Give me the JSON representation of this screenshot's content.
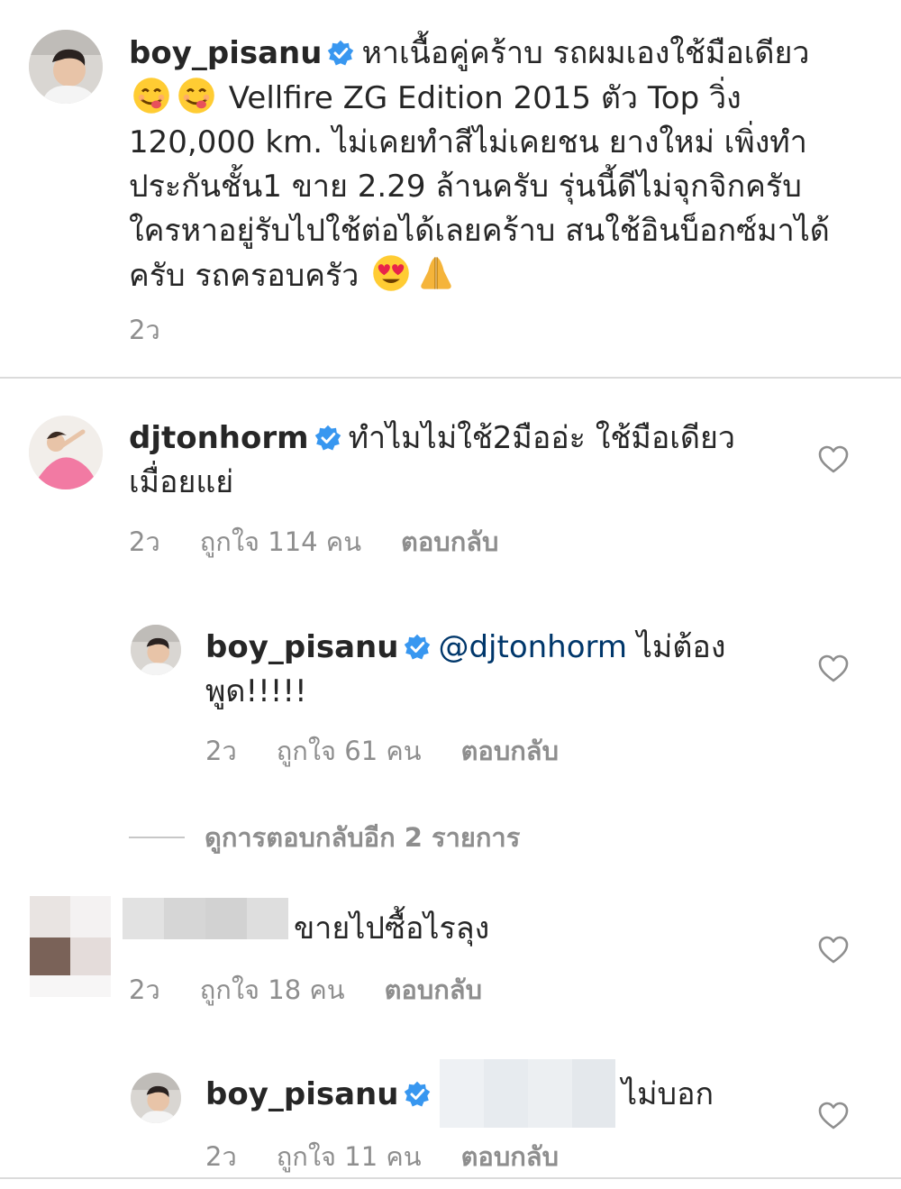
{
  "post": {
    "username": "boy_pisanu",
    "text_1": "หาเนื้อคู่คร้าบ รถผมเองใช้มือเดียว",
    "text_2": " Vellfire ZG Edition 2015 ตัว Top วิ่ง",
    "text_3": "120,000 km. ไม่เคยทำสีไม่เคยชน ยางใหม่ เพิ่งทำ",
    "text_4": "ประกันชั้น1 ขาย 2.29 ล้านครับ รุ่นนี้ดีไม่จุกจิกครับ",
    "text_5": "ใครหาอยู่รับไปใช้ต่อได้เลยคร้าบ สนใช้อินบ็อกซ์มาได้",
    "text_6": "ครับ รถครอบครัว ",
    "time": "2ว",
    "emojis": [
      "yum-face",
      "yum-face",
      "heart-eyes-face",
      "folded-hands"
    ]
  },
  "comments": [
    {
      "username": "djtonhorm",
      "text": "ทำไมไม่ใช้2มืออ่ะ ใช้มือเดียวเมื่อยแย่",
      "text_line1": "ทำไมไม่ใช้2มืออ่ะ ใช้มือเดียว",
      "text_line2": "เมื่อยแย่",
      "time": "2ว",
      "likes": "ถูกใจ 114 คน",
      "reply_label": "ตอบกลับ"
    },
    {
      "username": "boy_pisanu",
      "mention": "@djtonhorm",
      "text_line1": " ไม่ต้อง",
      "text_line2": "พูด!!!!!",
      "time": "2ว",
      "likes": "ถูกใจ 61 คน",
      "reply_label": "ตอบกลับ"
    },
    {
      "username": "",
      "text": "ขายไปซื้อไรลุง",
      "time": "2ว",
      "likes": "ถูกใจ 18 คน",
      "reply_label": "ตอบกลับ"
    },
    {
      "username": "boy_pisanu",
      "mention_prefix": "(",
      "text": "ไม่บอก",
      "time": "2ว",
      "likes": "ถูกใจ 11 คน",
      "reply_label": "ตอบกลับ"
    }
  ],
  "view_replies": "ดูการตอบกลับอีก 2 รายการ",
  "colors": {
    "verified": "#3897f0",
    "meta": "#8e8e8e",
    "mention": "#00376b",
    "divider": "#dbdbdb"
  },
  "icons": [
    "verified-badge-icon",
    "heart-outline-icon"
  ]
}
